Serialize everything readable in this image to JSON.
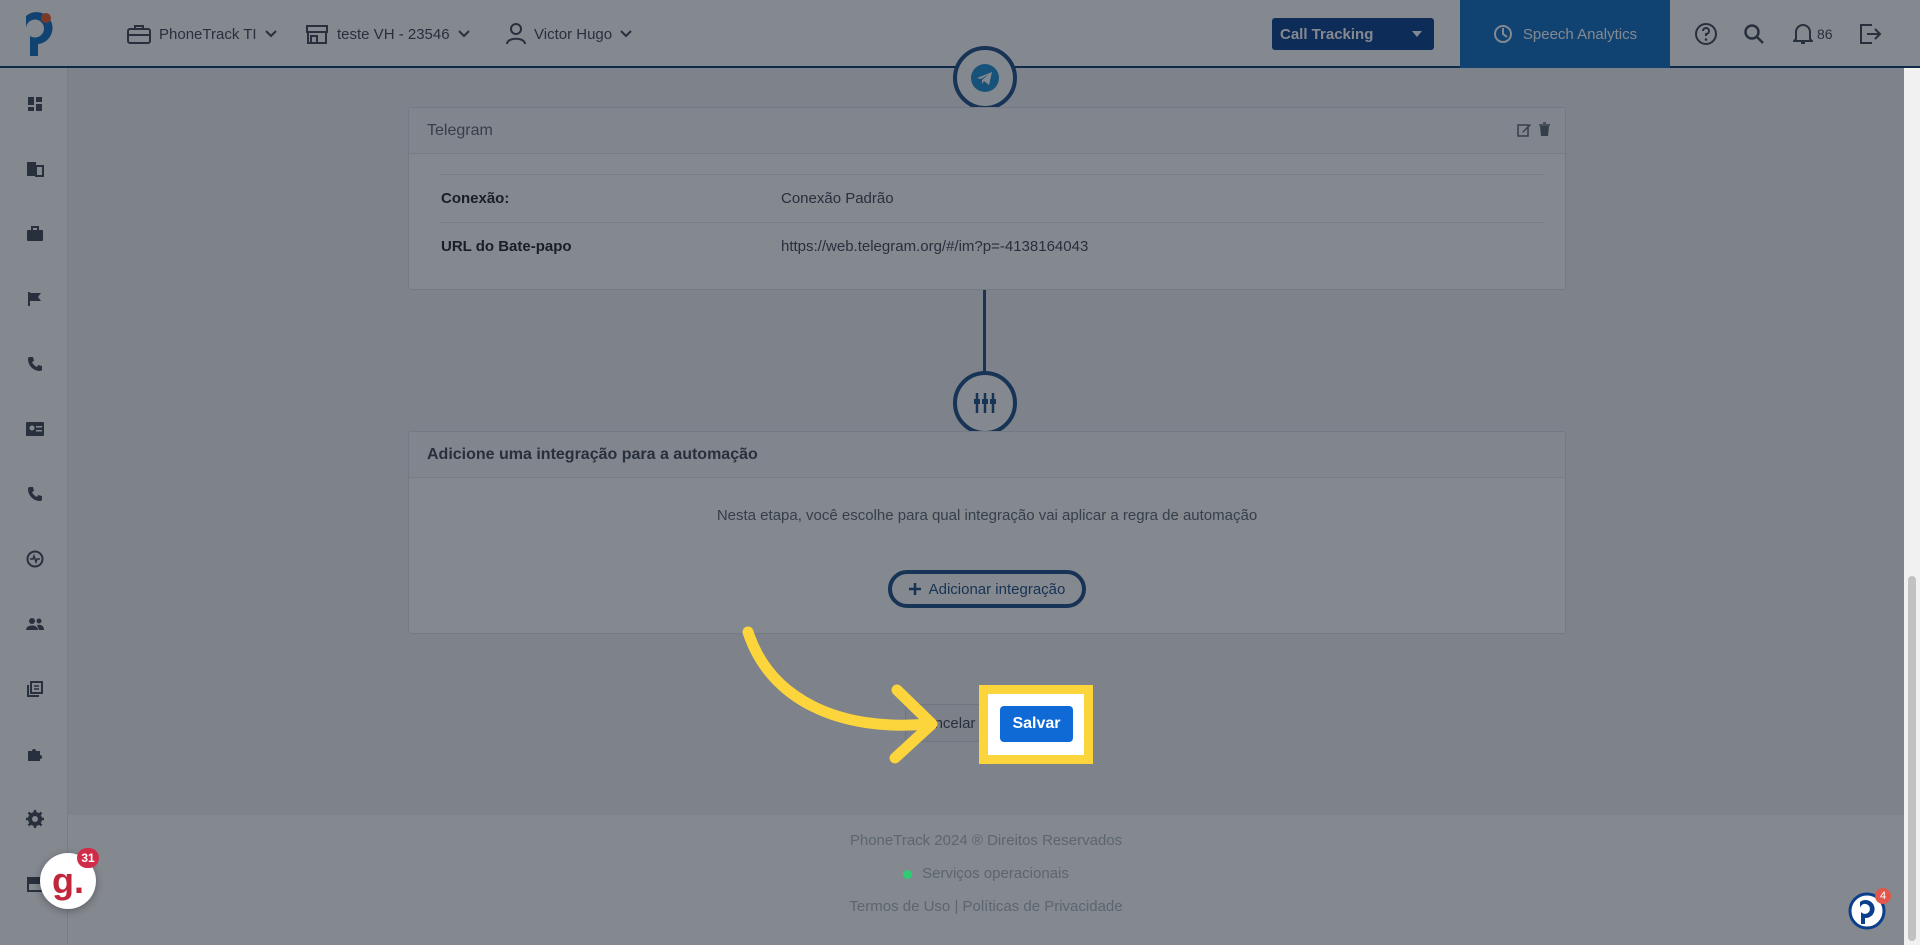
{
  "topbar": {
    "account": "PhoneTrack TI",
    "store": "teste VH - 23546",
    "user": "Victor Hugo",
    "product_select": "Call Tracking",
    "speech_tab": "Speech Analytics",
    "notifications_count": "86"
  },
  "sidebar": {
    "items": [
      "dashboard-icon",
      "building-icon",
      "briefcase-icon",
      "flag-icon",
      "phone-icon",
      "contact-card-icon",
      "phone-icon",
      "pulse-icon",
      "users-icon",
      "library-icon",
      "puzzle-icon",
      "settings-icon",
      "store-icon"
    ]
  },
  "telegram_card": {
    "title": "Telegram",
    "rows": [
      {
        "key": "Conexão:",
        "value": "Conexão Padrão"
      },
      {
        "key": "URL do Bate-papo",
        "value": "https://web.telegram.org/#/im?p=-4138164043"
      }
    ]
  },
  "integration_card": {
    "title": "Adicione uma integração para a automação",
    "description": "Nesta etapa, você escolhe para qual integração vai aplicar a regra de automação",
    "add_button": "Adicionar integração"
  },
  "actions": {
    "cancel_label": "ncelar",
    "save_label": "Salvar"
  },
  "footer": {
    "copyright": "PhoneTrack 2024 ® Direitos Reservados",
    "status": "Serviços operacionais",
    "links": "Termos de Uso | Políticas de Privacidade"
  },
  "widgets": {
    "g_badge_letter": "g.",
    "g_badge_count": "31",
    "chat_count": "4"
  },
  "colors": {
    "primary_dark": "#1d4f86",
    "product_select_bg": "#0a3f8c",
    "speech_tab_bg": "#0f6fc2",
    "save_button": "#0f6ad6",
    "highlight": "#fcd43b"
  }
}
